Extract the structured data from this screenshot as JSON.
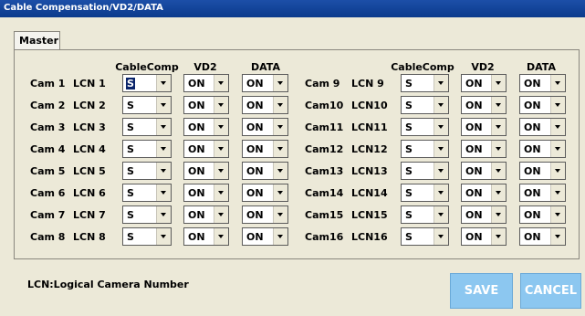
{
  "window": {
    "title": "Cable Compensation/VD2/DATA"
  },
  "tab": {
    "label": "Master"
  },
  "headers": {
    "cablecomp": "CableComp",
    "vd2": "VD2",
    "data": "DATA"
  },
  "left_rows": [
    {
      "cam": "Cam 1",
      "lcn": "LCN 1",
      "cablecomp": "S",
      "vd2": "ON",
      "data": "ON"
    },
    {
      "cam": "Cam 2",
      "lcn": "LCN 2",
      "cablecomp": "S",
      "vd2": "ON",
      "data": "ON"
    },
    {
      "cam": "Cam 3",
      "lcn": "LCN 3",
      "cablecomp": "S",
      "vd2": "ON",
      "data": "ON"
    },
    {
      "cam": "Cam 4",
      "lcn": "LCN 4",
      "cablecomp": "S",
      "vd2": "ON",
      "data": "ON"
    },
    {
      "cam": "Cam 5",
      "lcn": "LCN 5",
      "cablecomp": "S",
      "vd2": "ON",
      "data": "ON"
    },
    {
      "cam": "Cam 6",
      "lcn": "LCN 6",
      "cablecomp": "S",
      "vd2": "ON",
      "data": "ON"
    },
    {
      "cam": "Cam 7",
      "lcn": "LCN 7",
      "cablecomp": "S",
      "vd2": "ON",
      "data": "ON"
    },
    {
      "cam": "Cam 8",
      "lcn": "LCN 8",
      "cablecomp": "S",
      "vd2": "ON",
      "data": "ON"
    }
  ],
  "right_rows": [
    {
      "cam": "Cam 9",
      "lcn": "LCN 9",
      "cablecomp": "S",
      "vd2": "ON",
      "data": "ON"
    },
    {
      "cam": "Cam10",
      "lcn": "LCN10",
      "cablecomp": "S",
      "vd2": "ON",
      "data": "ON"
    },
    {
      "cam": "Cam11",
      "lcn": "LCN11",
      "cablecomp": "S",
      "vd2": "ON",
      "data": "ON"
    },
    {
      "cam": "Cam12",
      "lcn": "LCN12",
      "cablecomp": "S",
      "vd2": "ON",
      "data": "ON"
    },
    {
      "cam": "Cam13",
      "lcn": "LCN13",
      "cablecomp": "S",
      "vd2": "ON",
      "data": "ON"
    },
    {
      "cam": "Cam14",
      "lcn": "LCN14",
      "cablecomp": "S",
      "vd2": "ON",
      "data": "ON"
    },
    {
      "cam": "Cam15",
      "lcn": "LCN15",
      "cablecomp": "S",
      "vd2": "ON",
      "data": "ON"
    },
    {
      "cam": "Cam16",
      "lcn": "LCN16",
      "cablecomp": "S",
      "vd2": "ON",
      "data": "ON"
    }
  ],
  "legend": "LCN:Logical Camera Number",
  "buttons": {
    "save": "SAVE",
    "cancel": "CANCEL"
  },
  "colors": {
    "title_bar": "#0b3a8c",
    "button_bg": "#8cc7f0",
    "focus": "#0a246a"
  }
}
